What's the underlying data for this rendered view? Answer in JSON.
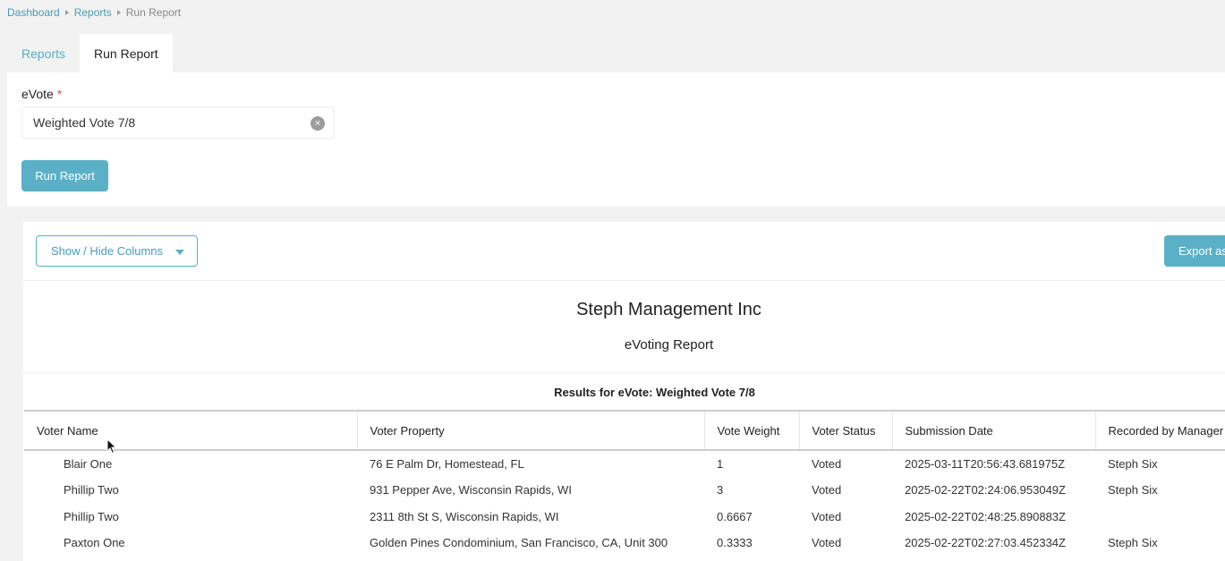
{
  "breadcrumb": {
    "items": [
      "Dashboard",
      "Reports"
    ],
    "current": "Run Report"
  },
  "tabs": [
    {
      "label": "Reports"
    },
    {
      "label": "Run Report"
    }
  ],
  "form": {
    "evote_label": "eVote",
    "required_mark": "*",
    "evote_value": "Weighted Vote 7/8",
    "run_button": "Run Report"
  },
  "report": {
    "show_hide": "Show / Hide Columns",
    "export": "Export as",
    "title": "Steph Management Inc",
    "subtitle": "eVoting Report",
    "results_for": "Results for eVote: Weighted Vote 7/8",
    "columns": [
      "Voter Name",
      "Voter Property",
      "Vote Weight",
      "Voter Status",
      "Submission Date",
      "Recorded by Manager"
    ],
    "rows": [
      [
        "Blair One",
        "76 E Palm Dr, Homestead, FL",
        "1",
        "Voted",
        "2025-03-11T20:56:43.681975Z",
        "Steph Six"
      ],
      [
        "Phillip Two",
        "931 Pepper Ave, Wisconsin Rapids, WI",
        "3",
        "Voted",
        "2025-02-22T02:24:06.953049Z",
        "Steph Six"
      ],
      [
        "Phillip Two",
        "2311 8th St S, Wisconsin Rapids, WI",
        "0.6667",
        "Voted",
        "2025-02-22T02:48:25.890883Z",
        ""
      ],
      [
        "Paxton One",
        "Golden Pines Condominium, San Francisco, CA, Unit 300",
        "0.3333",
        "Voted",
        "2025-02-22T02:27:03.452334Z",
        "Steph Six"
      ]
    ]
  },
  "colors": {
    "accent": "#5ab0c6",
    "link": "#4a9bb8",
    "required": "#d9534f"
  }
}
